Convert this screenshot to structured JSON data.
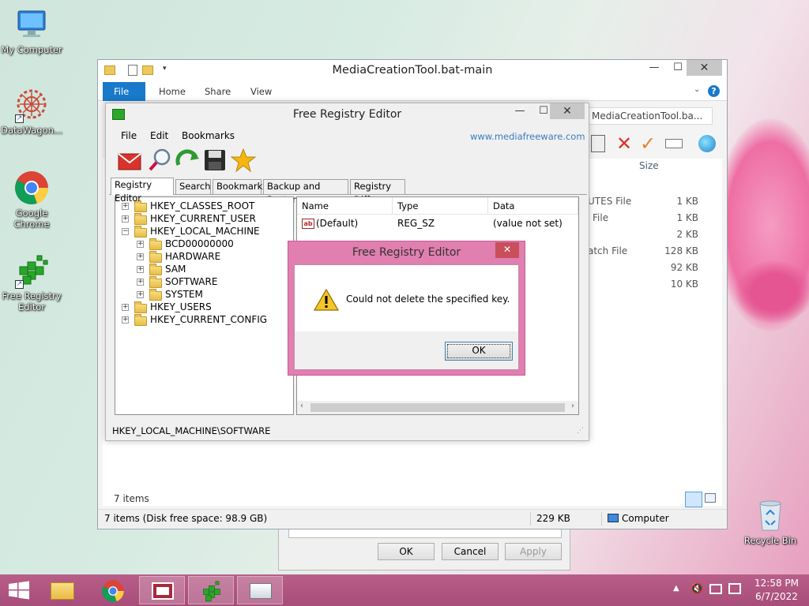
{
  "desktop": {
    "icons": [
      {
        "label": "My Computer"
      },
      {
        "label": "DataWagon..."
      },
      {
        "label": "Google Chrome"
      },
      {
        "label": "Free Registry Editor"
      },
      {
        "label": "Recycle Bin"
      }
    ]
  },
  "explorer": {
    "title": "MediaCreationTool.bat-main",
    "ribbon_tabs": [
      "File",
      "Home",
      "Share",
      "View"
    ],
    "address": "MediaCreationTool.ba...",
    "column_size": "Size",
    "files": [
      {
        "type": "UTES File",
        "size": "1 KB"
      },
      {
        "type": "File",
        "size": "1 KB"
      },
      {
        "type": "",
        "size": "2 KB"
      },
      {
        "type": "atch File",
        "size": "128 KB"
      },
      {
        "type": "",
        "size": "92 KB"
      },
      {
        "type": "",
        "size": "10 KB"
      }
    ],
    "item_count": "7 items",
    "status_left": "7 items (Disk free space: 98.9 GB)",
    "status_size": "229 KB",
    "status_location": "Computer"
  },
  "background_dialog": {
    "ok": "OK",
    "cancel": "Cancel",
    "apply": "Apply"
  },
  "registry_editor": {
    "title": "Free Registry Editor",
    "menu": [
      "File",
      "Edit",
      "Bookmarks"
    ],
    "website": "www.mediafreeware.com",
    "tabs": [
      "Registry Editor",
      "Search",
      "Bookmarks",
      "Backup and Restore",
      "Registry Diff"
    ],
    "tree": [
      {
        "label": "HKEY_CLASSES_ROOT",
        "level": 0,
        "expanded": false
      },
      {
        "label": "HKEY_CURRENT_USER",
        "level": 0,
        "expanded": false
      },
      {
        "label": "HKEY_LOCAL_MACHINE",
        "level": 0,
        "expanded": true
      },
      {
        "label": "BCD00000000",
        "level": 1,
        "expanded": false
      },
      {
        "label": "HARDWARE",
        "level": 1,
        "expanded": false
      },
      {
        "label": "SAM",
        "level": 1,
        "expanded": false
      },
      {
        "label": "SOFTWARE",
        "level": 1,
        "expanded": false
      },
      {
        "label": "SYSTEM",
        "level": 1,
        "expanded": false
      },
      {
        "label": "HKEY_USERS",
        "level": 0,
        "expanded": false
      },
      {
        "label": "HKEY_CURRENT_CONFIG",
        "level": 0,
        "expanded": false
      }
    ],
    "columns": [
      "Name",
      "Type",
      "Data"
    ],
    "values": [
      {
        "name": "(Default)",
        "type": "REG_SZ",
        "data": "(value not set)"
      }
    ],
    "status_path": "HKEY_LOCAL_MACHINE\\SOFTWARE"
  },
  "error_dialog": {
    "title": "Free Registry Editor",
    "message": "Could not delete the specified key.",
    "ok": "OK",
    "close": "✕"
  },
  "taskbar": {
    "time": "12:58 PM",
    "date": "6/7/2022"
  }
}
